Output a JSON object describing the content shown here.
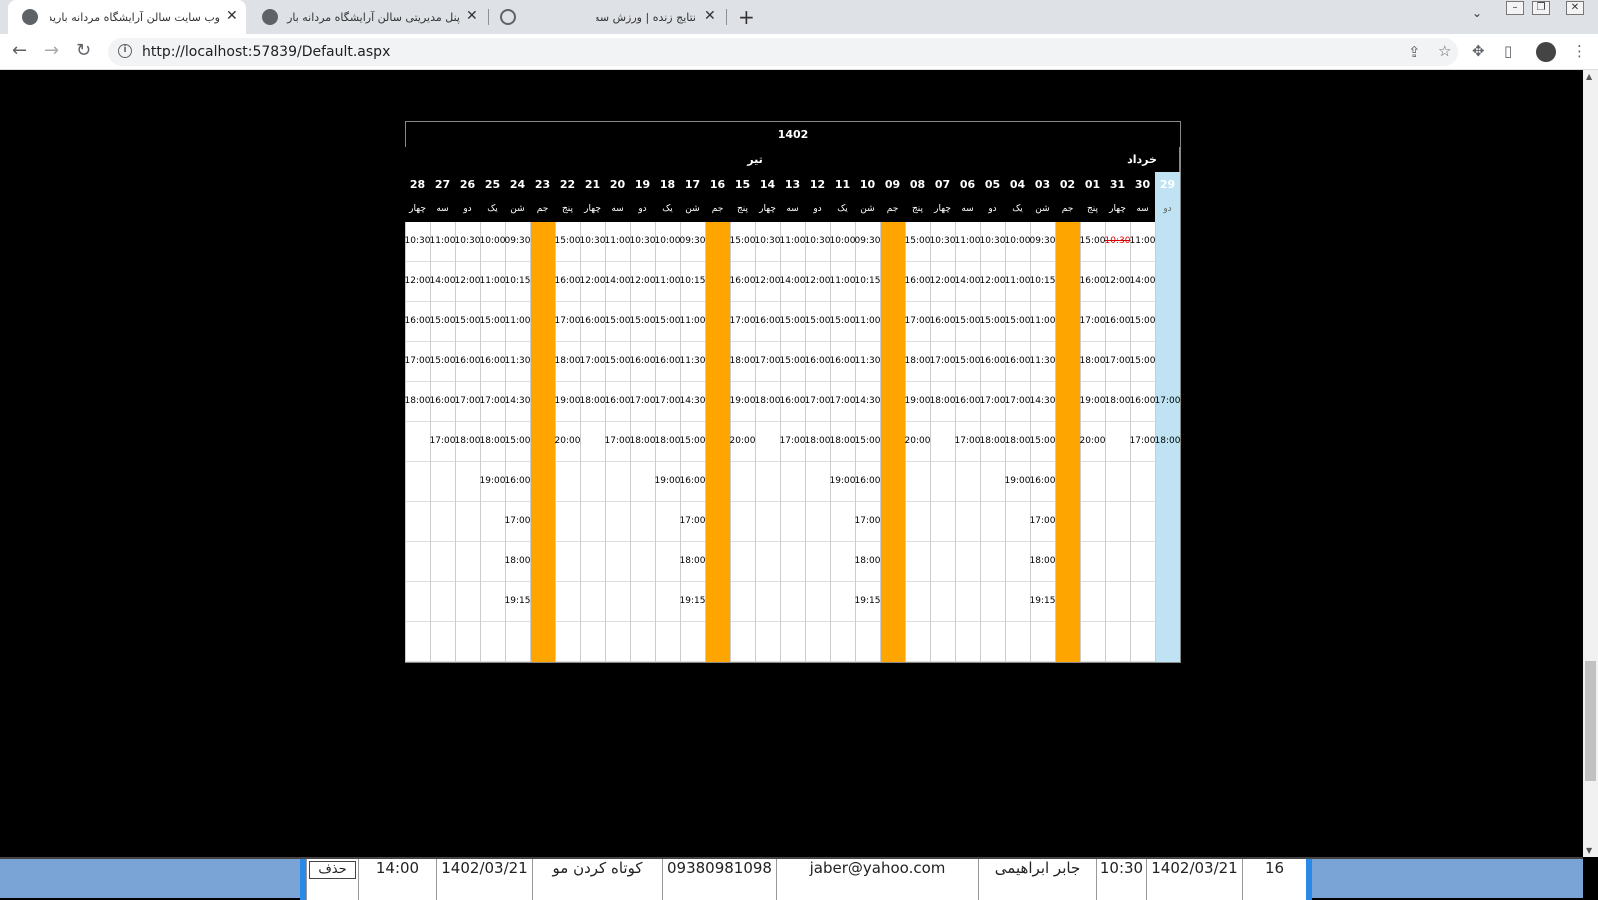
{
  "browser": {
    "tabs": [
      {
        "title": "وب سایت سالن آرایشگاه مردانه بارید",
        "active": true
      },
      {
        "title": "پنل مدیریتی سالن آرایشگاه مردانه بار",
        "active": false
      },
      {
        "title": "نتایج زنده | ورزش سه",
        "active": false
      }
    ],
    "url": "http://localhost:57839/Default.aspx"
  },
  "calendar": {
    "year": "1402",
    "months": [
      {
        "name": "خرداد",
        "span": 3
      },
      {
        "name": "تیر",
        "span": 28
      }
    ],
    "colors": {
      "holiday": "#ffa500",
      "today": "#bfe3f2",
      "booked": "#dd0000"
    },
    "days": [
      {
        "num": "29",
        "name": "دو",
        "today": true,
        "holiday": false,
        "slots": [
          "",
          "",
          "",
          "",
          "17:00",
          "18:00",
          "",
          "",
          "",
          "",
          ""
        ]
      },
      {
        "num": "30",
        "name": "سه",
        "holiday": false,
        "slots": [
          "11:00",
          "14:00",
          "15:00",
          "15:00",
          "16:00",
          "17:00",
          "",
          "",
          "",
          "",
          ""
        ]
      },
      {
        "num": "31",
        "name": "چهار",
        "holiday": false,
        "slots": [
          {
            "t": "10:30",
            "booked": true
          },
          "12:00",
          "16:00",
          "17:00",
          "18:00",
          "",
          "",
          "",
          "",
          "",
          ""
        ]
      },
      {
        "num": "01",
        "name": "پنج",
        "holiday": false,
        "slots": [
          "15:00",
          "16:00",
          "17:00",
          "18:00",
          "19:00",
          "20:00",
          "",
          "",
          "",
          "",
          ""
        ]
      },
      {
        "num": "02",
        "name": "جم",
        "holiday": true,
        "slots": []
      },
      {
        "num": "03",
        "name": "شن",
        "holiday": false,
        "slots": [
          "09:30",
          "10:15",
          "11:00",
          "11:30",
          "14:30",
          "15:00",
          "16:00",
          "17:00",
          "18:00",
          "19:15",
          ""
        ]
      },
      {
        "num": "04",
        "name": "یک",
        "holiday": false,
        "slots": [
          "10:00",
          "11:00",
          "15:00",
          "16:00",
          "17:00",
          "18:00",
          "19:00",
          "",
          "",
          "",
          ""
        ]
      },
      {
        "num": "05",
        "name": "دو",
        "holiday": false,
        "slots": [
          "10:30",
          "12:00",
          "15:00",
          "16:00",
          "17:00",
          "18:00",
          "",
          "",
          "",
          "",
          ""
        ]
      },
      {
        "num": "06",
        "name": "سه",
        "holiday": false,
        "slots": [
          "11:00",
          "14:00",
          "15:00",
          "15:00",
          "16:00",
          "17:00",
          "",
          "",
          "",
          "",
          ""
        ]
      },
      {
        "num": "07",
        "name": "چهار",
        "holiday": false,
        "slots": [
          "10:30",
          "12:00",
          "16:00",
          "17:00",
          "18:00",
          "",
          "",
          "",
          "",
          "",
          ""
        ]
      },
      {
        "num": "08",
        "name": "پنج",
        "holiday": false,
        "slots": [
          "15:00",
          "16:00",
          "17:00",
          "18:00",
          "19:00",
          "20:00",
          "",
          "",
          "",
          "",
          ""
        ]
      },
      {
        "num": "09",
        "name": "جم",
        "holiday": true,
        "slots": []
      },
      {
        "num": "10",
        "name": "شن",
        "holiday": false,
        "slots": [
          "09:30",
          "10:15",
          "11:00",
          "11:30",
          "14:30",
          "15:00",
          "16:00",
          "17:00",
          "18:00",
          "19:15",
          ""
        ]
      },
      {
        "num": "11",
        "name": "یک",
        "holiday": false,
        "slots": [
          "10:00",
          "11:00",
          "15:00",
          "16:00",
          "17:00",
          "18:00",
          "19:00",
          "",
          "",
          "",
          ""
        ]
      },
      {
        "num": "12",
        "name": "دو",
        "holiday": false,
        "slots": [
          "10:30",
          "12:00",
          "15:00",
          "16:00",
          "17:00",
          "18:00",
          "",
          "",
          "",
          "",
          ""
        ]
      },
      {
        "num": "13",
        "name": "سه",
        "holiday": false,
        "slots": [
          "11:00",
          "14:00",
          "15:00",
          "15:00",
          "16:00",
          "17:00",
          "",
          "",
          "",
          "",
          ""
        ]
      },
      {
        "num": "14",
        "name": "چهار",
        "holiday": false,
        "slots": [
          "10:30",
          "12:00",
          "16:00",
          "17:00",
          "18:00",
          "",
          "",
          "",
          "",
          "",
          ""
        ]
      },
      {
        "num": "15",
        "name": "پنج",
        "holiday": false,
        "slots": [
          "15:00",
          "16:00",
          "17:00",
          "18:00",
          "19:00",
          "20:00",
          "",
          "",
          "",
          "",
          ""
        ]
      },
      {
        "num": "16",
        "name": "جم",
        "holiday": true,
        "slots": []
      },
      {
        "num": "17",
        "name": "شن",
        "holiday": false,
        "slots": [
          "09:30",
          "10:15",
          "11:00",
          "11:30",
          "14:30",
          "15:00",
          "16:00",
          "17:00",
          "18:00",
          "19:15",
          ""
        ]
      },
      {
        "num": "18",
        "name": "یک",
        "holiday": false,
        "slots": [
          "10:00",
          "11:00",
          "15:00",
          "16:00",
          "17:00",
          "18:00",
          "19:00",
          "",
          "",
          "",
          ""
        ]
      },
      {
        "num": "19",
        "name": "دو",
        "holiday": false,
        "slots": [
          "10:30",
          "12:00",
          "15:00",
          "16:00",
          "17:00",
          "18:00",
          "",
          "",
          "",
          "",
          ""
        ]
      },
      {
        "num": "20",
        "name": "سه",
        "holiday": false,
        "slots": [
          "11:00",
          "14:00",
          "15:00",
          "15:00",
          "16:00",
          "17:00",
          "",
          "",
          "",
          "",
          ""
        ]
      },
      {
        "num": "21",
        "name": "چهار",
        "holiday": false,
        "slots": [
          "10:30",
          "12:00",
          "16:00",
          "17:00",
          "18:00",
          "",
          "",
          "",
          "",
          "",
          ""
        ]
      },
      {
        "num": "22",
        "name": "پنج",
        "holiday": false,
        "slots": [
          "15:00",
          "16:00",
          "17:00",
          "18:00",
          "19:00",
          "20:00",
          "",
          "",
          "",
          "",
          ""
        ]
      },
      {
        "num": "23",
        "name": "جم",
        "holiday": true,
        "slots": []
      },
      {
        "num": "24",
        "name": "شن",
        "holiday": false,
        "slots": [
          "09:30",
          "10:15",
          "11:00",
          "11:30",
          "14:30",
          "15:00",
          "16:00",
          "17:00",
          "18:00",
          "19:15",
          ""
        ]
      },
      {
        "num": "25",
        "name": "یک",
        "holiday": false,
        "slots": [
          "10:00",
          "11:00",
          "15:00",
          "16:00",
          "17:00",
          "18:00",
          "19:00",
          "",
          "",
          "",
          ""
        ]
      },
      {
        "num": "26",
        "name": "دو",
        "holiday": false,
        "slots": [
          "10:30",
          "12:00",
          "15:00",
          "16:00",
          "17:00",
          "18:00",
          "",
          "",
          "",
          "",
          ""
        ]
      },
      {
        "num": "27",
        "name": "سه",
        "holiday": false,
        "slots": [
          "11:00",
          "14:00",
          "15:00",
          "15:00",
          "16:00",
          "17:00",
          "",
          "",
          "",
          "",
          ""
        ]
      },
      {
        "num": "28",
        "name": "چهار",
        "holiday": false,
        "slots": [
          "10:30",
          "12:00",
          "16:00",
          "17:00",
          "18:00",
          "",
          "",
          "",
          "",
          "",
          ""
        ]
      }
    ]
  },
  "bottom_table": {
    "row": {
      "id": "16",
      "date": "1402/03/21",
      "time": "10:30",
      "name": "جابر ابراهیمی",
      "email": "jaber@yahoo.com",
      "phone": "09380981098",
      "service": "کوتاه کردن مو",
      "date2": "1402/03/21",
      "time2": "14:00",
      "delete_label": "حذف"
    }
  }
}
